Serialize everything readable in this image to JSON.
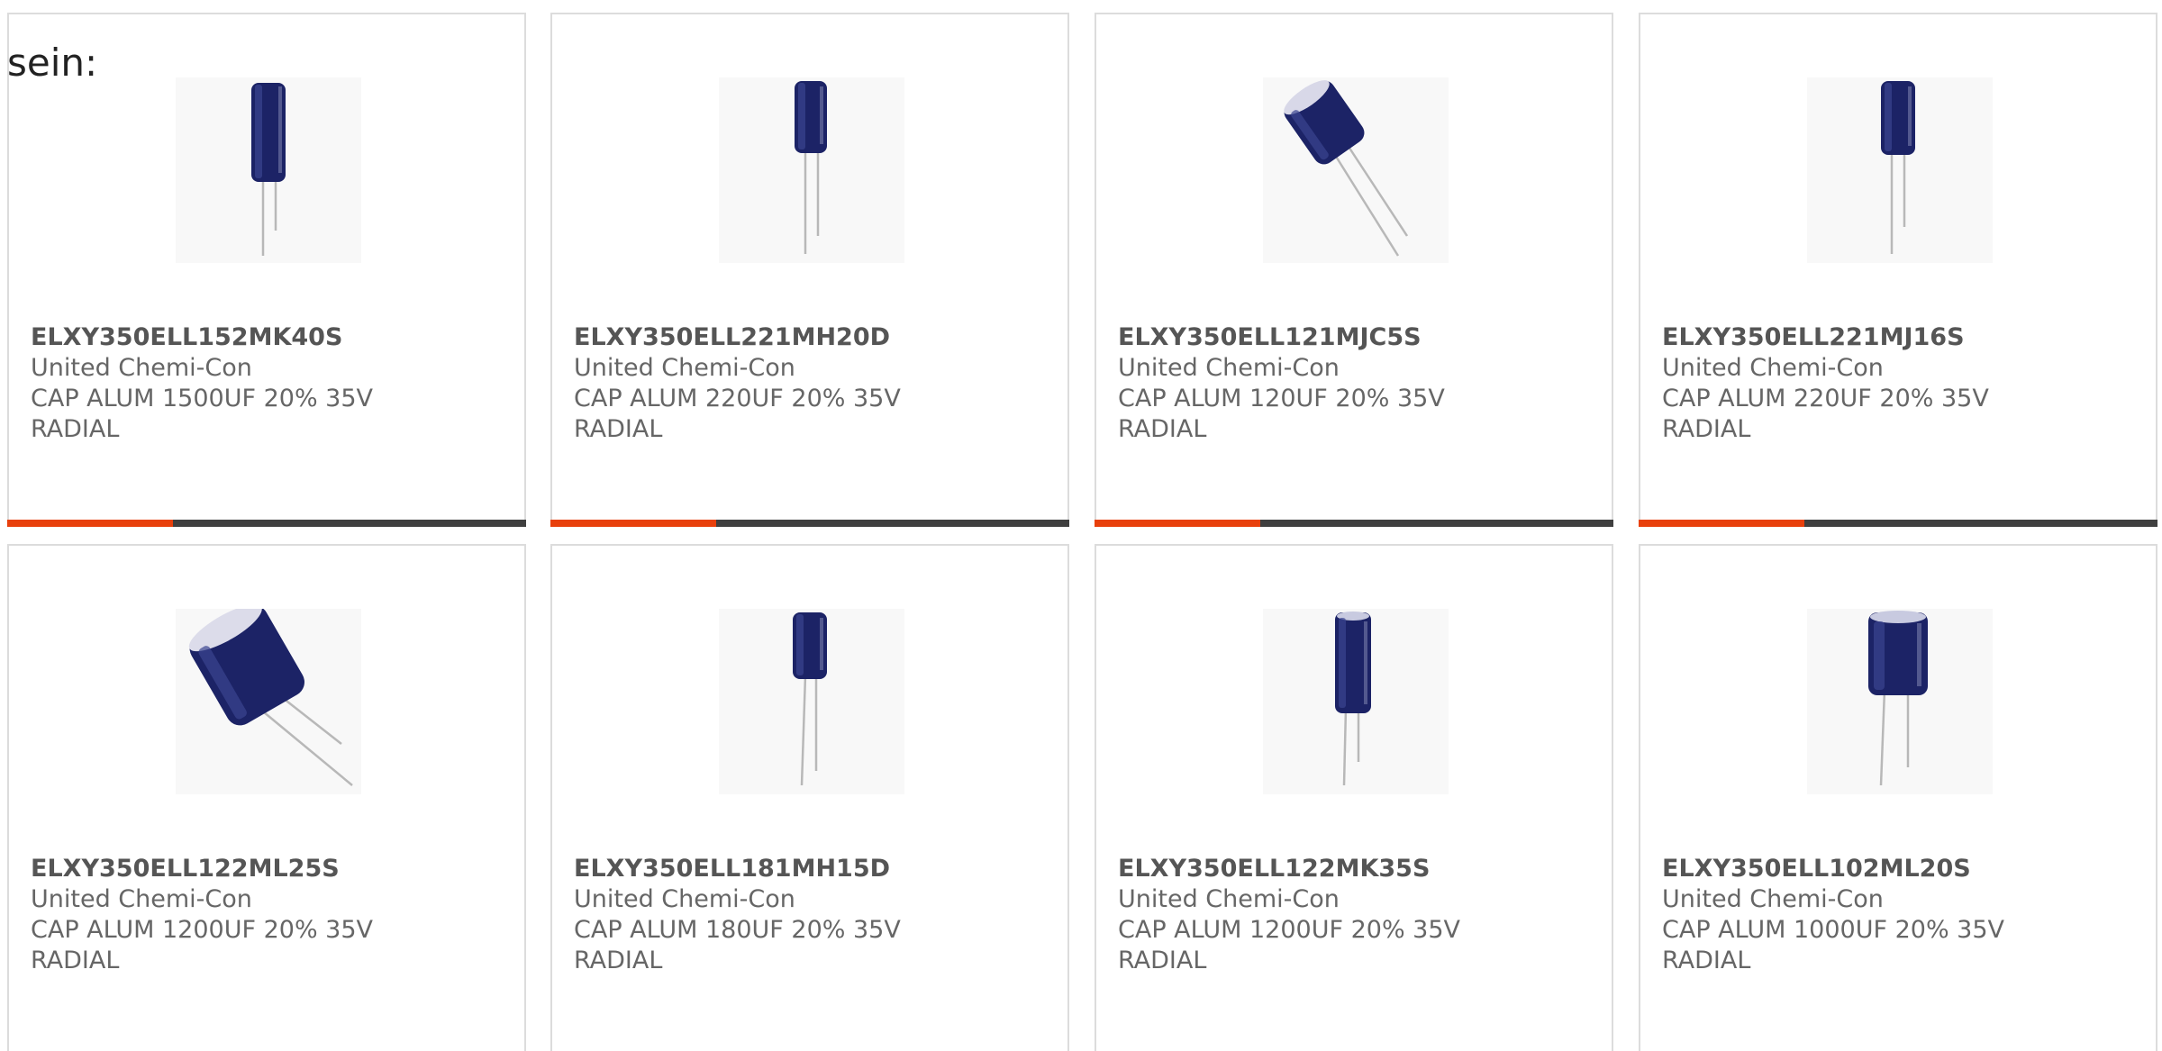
{
  "lead_text": "sein:",
  "colors": {
    "accent": "#e8400c",
    "bar": "#3f3f3f",
    "border": "#dcdcdc",
    "capacitor_body": "#1c2366"
  },
  "products": [
    {
      "part_number": "ELXY350ELL152MK40S",
      "manufacturer": "United Chemi-Con",
      "description": "CAP ALUM 1500UF 20% 35V",
      "package": "RADIAL",
      "image_icon": "radial-capacitor-image"
    },
    {
      "part_number": "ELXY350ELL221MH20D",
      "manufacturer": "United Chemi-Con",
      "description": "CAP ALUM 220UF 20% 35V",
      "package": "RADIAL",
      "image_icon": "radial-capacitor-image"
    },
    {
      "part_number": "ELXY350ELL121MJC5S",
      "manufacturer": "United Chemi-Con",
      "description": "CAP ALUM 120UF 20% 35V",
      "package": "RADIAL",
      "image_icon": "radial-capacitor-image"
    },
    {
      "part_number": "ELXY350ELL221MJ16S",
      "manufacturer": "United Chemi-Con",
      "description": "CAP ALUM 220UF 20% 35V",
      "package": "RADIAL",
      "image_icon": "radial-capacitor-image"
    },
    {
      "part_number": "ELXY350ELL122ML25S",
      "manufacturer": "United Chemi-Con",
      "description": "CAP ALUM 1200UF 20% 35V",
      "package": "RADIAL",
      "image_icon": "radial-capacitor-image"
    },
    {
      "part_number": "ELXY350ELL181MH15D",
      "manufacturer": "United Chemi-Con",
      "description": "CAP ALUM 180UF 20% 35V",
      "package": "RADIAL",
      "image_icon": "radial-capacitor-image"
    },
    {
      "part_number": "ELXY350ELL122MK35S",
      "manufacturer": "United Chemi-Con",
      "description": "CAP ALUM 1200UF 20% 35V",
      "package": "RADIAL",
      "image_icon": "radial-capacitor-image"
    },
    {
      "part_number": "ELXY350ELL102ML20S",
      "manufacturer": "United Chemi-Con",
      "description": "CAP ALUM 1000UF 20% 35V",
      "package": "RADIAL",
      "image_icon": "radial-capacitor-image"
    }
  ]
}
